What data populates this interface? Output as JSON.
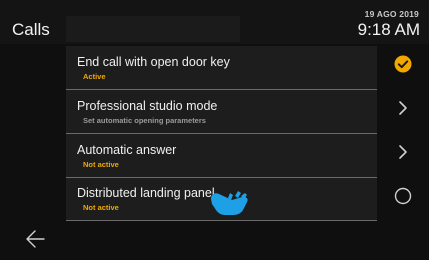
{
  "header": {
    "title": "Calls",
    "date": "19 AGO 2019",
    "time": "9:18 AM"
  },
  "items": [
    {
      "title": "End call with open door key",
      "subtitle": "Active",
      "control": "checkmark-circle-icon"
    },
    {
      "title": "Professional studio mode",
      "subtitle": "Set automatic opening parameters",
      "control": "chevron-right-icon"
    },
    {
      "title": "Automatic answer",
      "subtitle": "Not active",
      "control": "chevron-right-icon"
    },
    {
      "title": "Distributed landing panel",
      "subtitle": "Not active",
      "control": "radio-circle-icon"
    }
  ],
  "colors": {
    "accent": "#f0a800",
    "hand_pointer": "#1ea0e6",
    "background": "#0f0f0f",
    "list_background": "#1d1d1d"
  },
  "icons": {
    "back": "arrow-left-icon",
    "pointer": "hand-pointer-icon"
  }
}
